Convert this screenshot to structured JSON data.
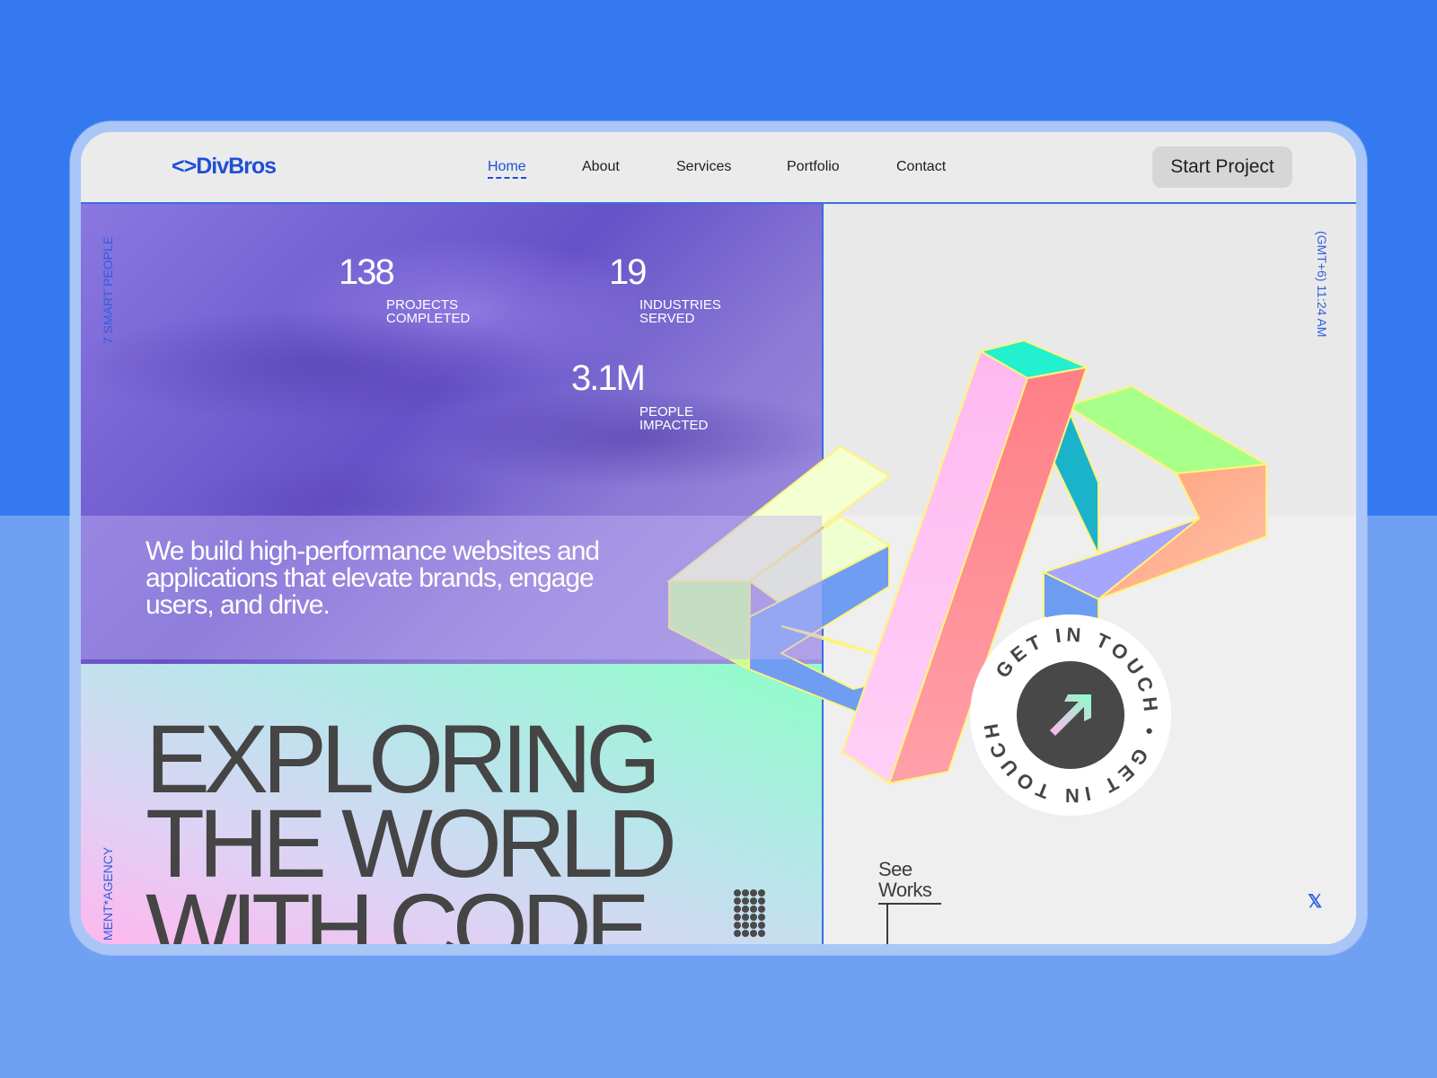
{
  "brand": {
    "logo": "<>DivBros"
  },
  "nav": {
    "items": [
      {
        "label": "Home",
        "active": true
      },
      {
        "label": "About"
      },
      {
        "label": "Services"
      },
      {
        "label": "Portfolio"
      },
      {
        "label": "Contact"
      }
    ],
    "cta": "Start Project"
  },
  "side": {
    "left_top": "7 SMART PEOPLE",
    "left_bottom": "MENT*AGENCY",
    "right_top": "(GMT+6) 11:24 AM"
  },
  "stats": [
    {
      "value": "138",
      "label_line1": "PROJECTS",
      "label_line2": "COMPLETED"
    },
    {
      "value": "19",
      "label_line1": "INDUSTRIES",
      "label_line2": "SERVED"
    },
    {
      "value": "3.1M",
      "label_line1": "PEOPLE",
      "label_line2": "IMPACTED"
    }
  ],
  "tagline": "We build high-performance websites and applications that elevate brands, engage users, and drive.",
  "headline": {
    "line1": "EXPLORING",
    "line2": "THE WORLD",
    "line3": "WITH CODE"
  },
  "badge": {
    "text": "GET IN TOUCH • GET IN TOUCH •",
    "icon": "arrow-up-right-icon"
  },
  "see_works": {
    "line1": "See",
    "line2": "Works"
  },
  "social": {
    "icon": "x-icon",
    "glyph": "𝕏"
  },
  "colors": {
    "accent": "#1f4fd6",
    "background": "#3479f0",
    "headline": "#454545"
  }
}
